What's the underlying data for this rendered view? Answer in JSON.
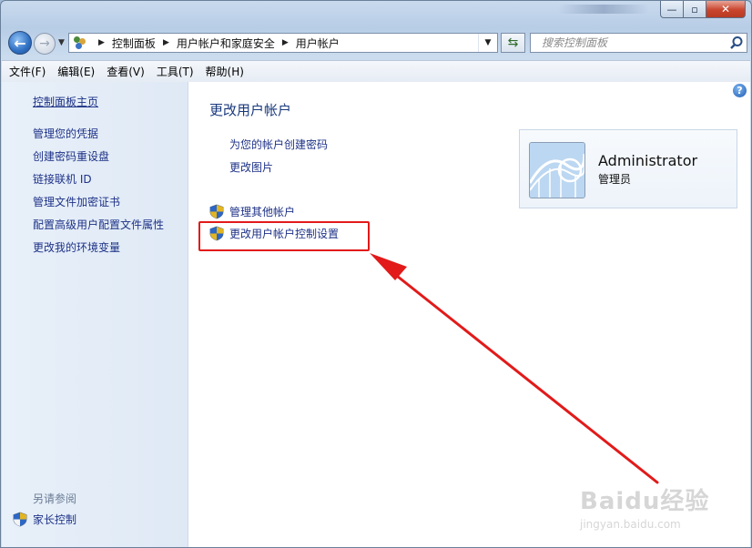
{
  "window": {
    "caption": {
      "minimize": "—",
      "maximize": "▫",
      "close": "✕"
    }
  },
  "nav": {
    "back_glyph": "←",
    "forward_glyph": "→",
    "breadcrumbs": [
      "控制面板",
      "用户帐户和家庭安全",
      "用户帐户"
    ],
    "search_placeholder": "搜索控制面板"
  },
  "menu": [
    "文件(F)",
    "编辑(E)",
    "查看(V)",
    "工具(T)",
    "帮助(H)"
  ],
  "sidebar": {
    "home": "控制面板主页",
    "links": [
      "管理您的凭据",
      "创建密码重设盘",
      "链接联机 ID",
      "管理文件加密证书",
      "配置高级用户配置文件属性",
      "更改我的环境变量"
    ],
    "see_also": "另请参阅",
    "parental": "家长控制"
  },
  "main": {
    "title": "更改用户帐户",
    "tasks": [
      "为您的帐户创建密码",
      "更改图片"
    ],
    "shield_tasks": [
      "管理其他帐户",
      "更改用户帐户控制设置"
    ],
    "help": "?"
  },
  "user": {
    "name": "Administrator",
    "role": "管理员"
  },
  "watermark": {
    "logo": "Baidu经验",
    "url": "jingyan.baidu.com"
  },
  "colors": {
    "link": "#1e3287",
    "highlight_box": "#e21a1a",
    "arrow": "#e21a1a"
  }
}
